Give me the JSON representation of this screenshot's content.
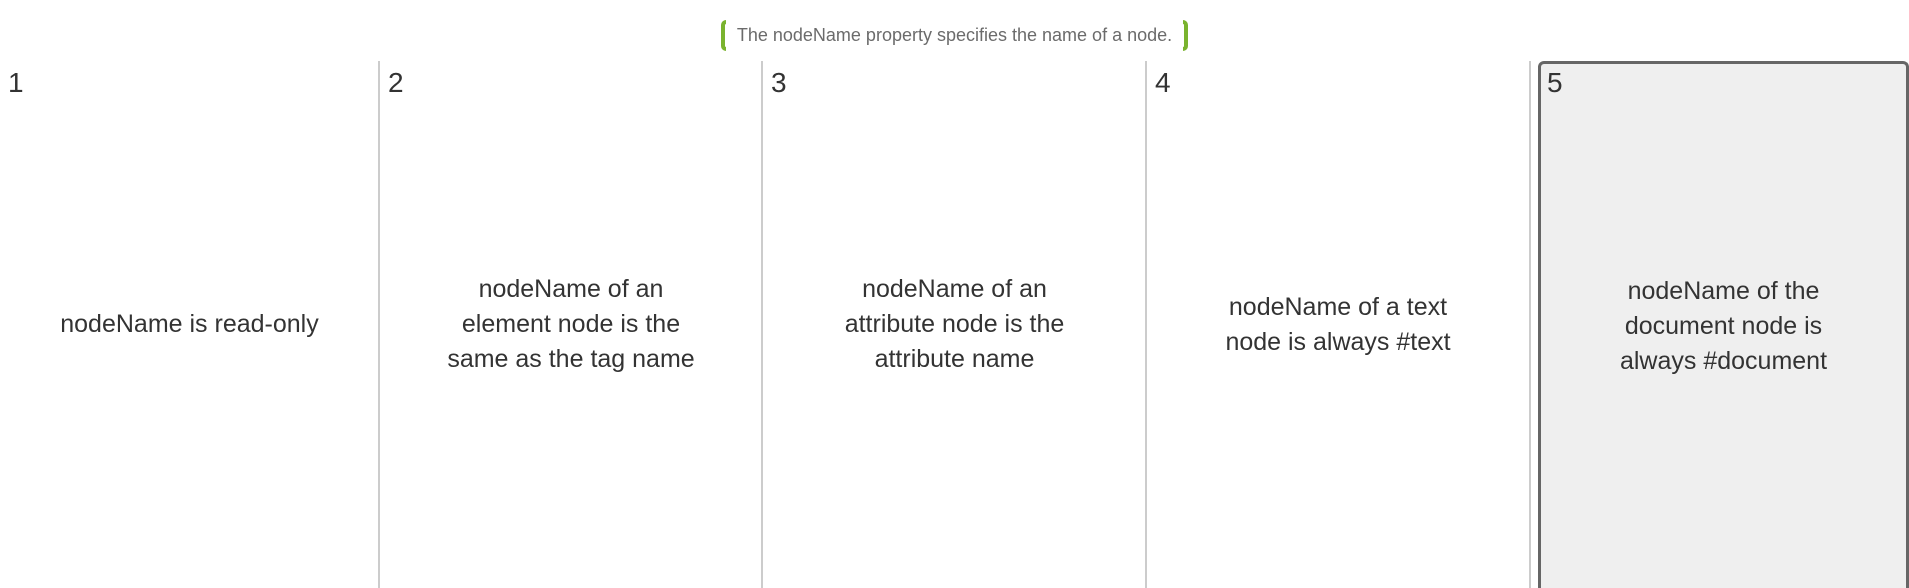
{
  "prompt": {
    "text": "The nodeName property specifies the name of a node."
  },
  "cards": [
    {
      "number": "1",
      "text": "nodeName is read-only",
      "selected": false
    },
    {
      "number": "2",
      "text": "nodeName of an element node is the same as the tag name",
      "selected": false
    },
    {
      "number": "3",
      "text": "nodeName of an attribute node is the attribute name",
      "selected": false
    },
    {
      "number": "4",
      "text": "nodeName of a text node is always #text",
      "selected": false
    },
    {
      "number": "5",
      "text": "nodeName of the document node is always #document",
      "selected": true
    }
  ],
  "colors": {
    "bracket": "#7ab32e",
    "divider": "#cccccc",
    "selected_bg": "#efefef",
    "selected_border": "#666666"
  }
}
